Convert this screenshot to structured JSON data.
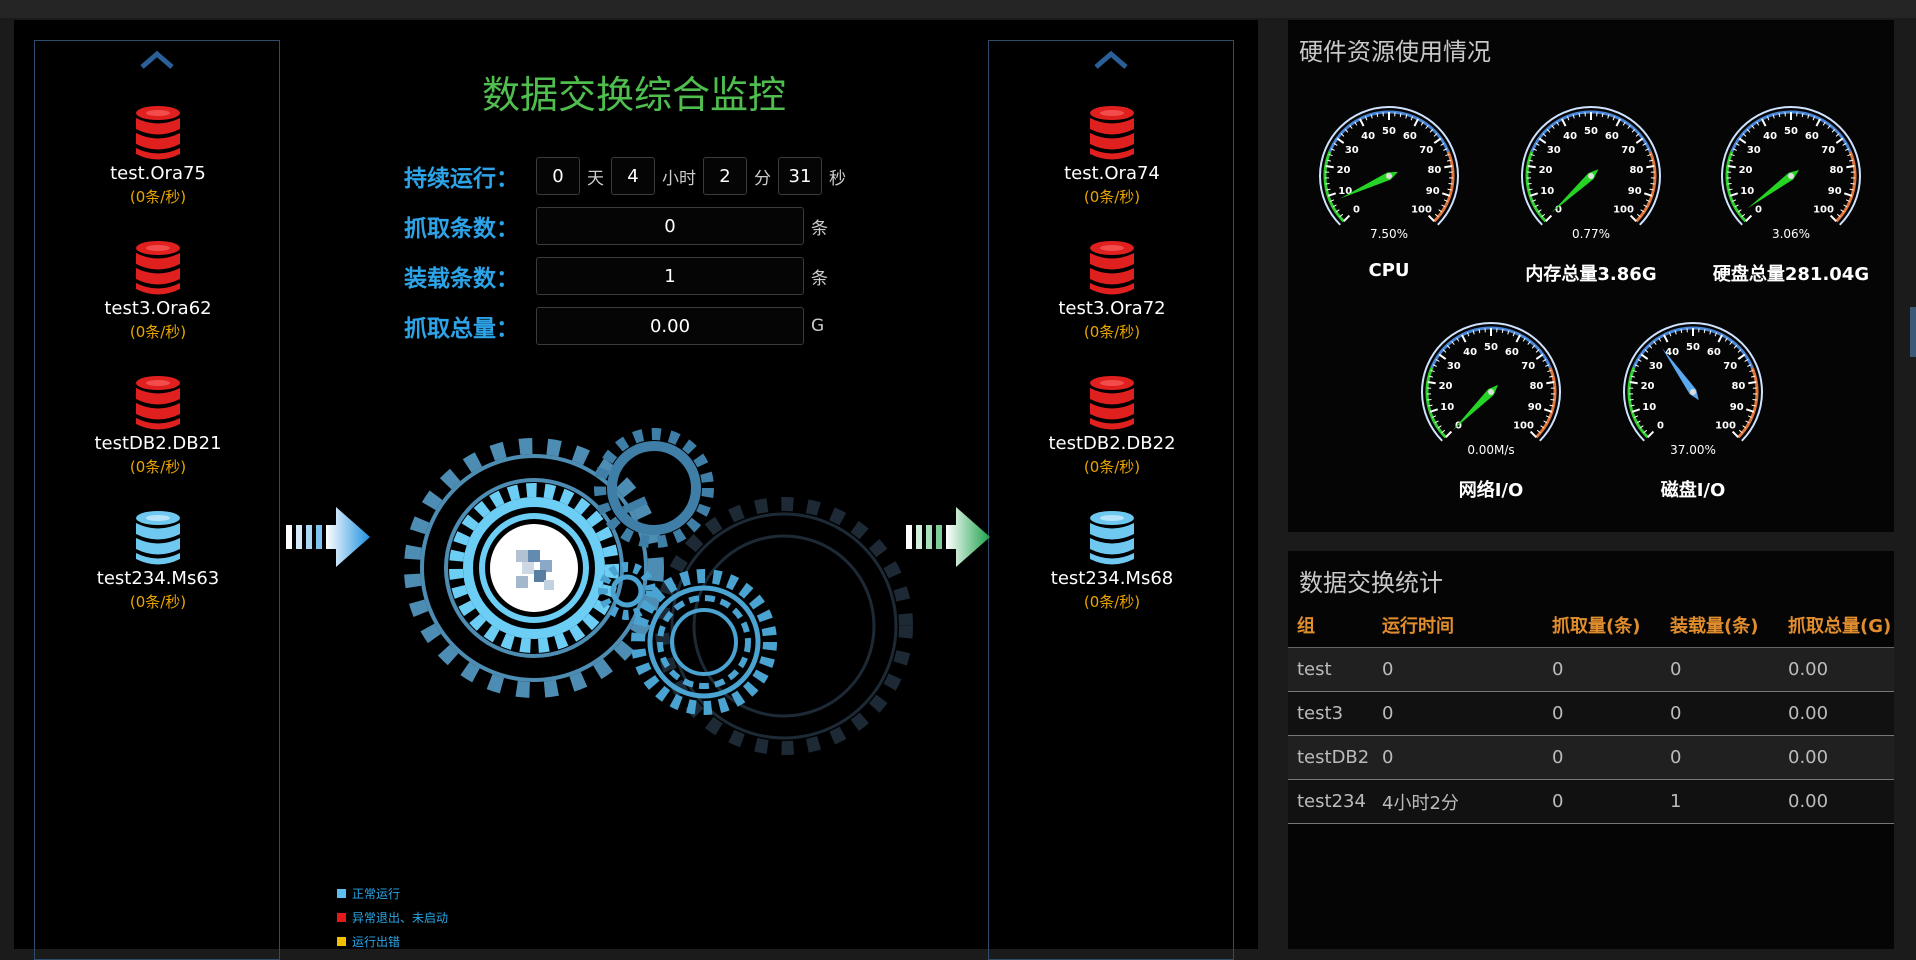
{
  "title": "数据交换综合监控",
  "runtime": {
    "label": "持续运行：",
    "days": "0",
    "day_unit": "天",
    "hours": "4",
    "hour_unit": "小时",
    "minutes": "2",
    "minute_unit": "分",
    "seconds": "31",
    "second_unit": "秒"
  },
  "fetch_count": {
    "label": "抓取条数：",
    "value": "0",
    "unit": "条"
  },
  "load_count": {
    "label": "装载条数：",
    "value": "1",
    "unit": "条"
  },
  "fetch_total": {
    "label": "抓取总量：",
    "value": "0.00",
    "unit": "G"
  },
  "source_dbs": [
    {
      "name": "test.Ora75",
      "rate": "(0条/秒)",
      "status": "red"
    },
    {
      "name": "test3.Ora62",
      "rate": "(0条/秒)",
      "status": "red"
    },
    {
      "name": "testDB2.DB21",
      "rate": "(0条/秒)",
      "status": "red"
    },
    {
      "name": "test234.Ms63",
      "rate": "(0条/秒)",
      "status": "blue"
    }
  ],
  "target_dbs": [
    {
      "name": "test.Ora74",
      "rate": "(0条/秒)",
      "status": "red"
    },
    {
      "name": "test3.Ora72",
      "rate": "(0条/秒)",
      "status": "red"
    },
    {
      "name": "testDB2.DB22",
      "rate": "(0条/秒)",
      "status": "red"
    },
    {
      "name": "test234.Ms68",
      "rate": "(0条/秒)",
      "status": "blue"
    }
  ],
  "legend": [
    {
      "label": "正常运行",
      "color": "#5bc0f0"
    },
    {
      "label": "异常退出、未启动",
      "color": "#e11b1b"
    },
    {
      "label": "运行出错",
      "color": "#f0c000"
    }
  ],
  "hardware": {
    "title": "硬件资源使用情况",
    "gauges": [
      {
        "label": "CPU",
        "reading": "7.50%",
        "value": 7.5
      },
      {
        "label": "内存总量3.86G",
        "reading": "0.77%",
        "value": 0.77
      },
      {
        "label": "硬盘总量281.04G",
        "reading": "3.06%",
        "value": 3.06
      },
      {
        "label": "网络I/O",
        "reading": "0.00M/s",
        "value": 0
      },
      {
        "label": "磁盘I/O",
        "reading": "37.00%",
        "value": 37
      }
    ],
    "ticks": [
      "0",
      "10",
      "20",
      "30",
      "40",
      "50",
      "60",
      "70",
      "80",
      "90",
      "100"
    ]
  },
  "stats": {
    "title": "数据交换统计",
    "columns": [
      "组",
      "运行时间",
      "抓取量(条)",
      "装载量(条)",
      "抓取总量(G)"
    ],
    "rows": [
      [
        "test",
        "0",
        "0",
        "0",
        "0.00"
      ],
      [
        "test3",
        "0",
        "0",
        "0",
        "0.00"
      ],
      [
        "testDB2",
        "0",
        "0",
        "0",
        "0.00"
      ],
      [
        "test234",
        "4小时2分",
        "0",
        "1",
        "0.00"
      ]
    ]
  },
  "colors": {
    "db_red": "#e0201e",
    "db_blue": "#6fc8f0",
    "title_green": "#4fbe4f",
    "label_blue": "#2da3e8",
    "rate_orange": "#e9a400",
    "header_orange": "#e08d2e"
  }
}
